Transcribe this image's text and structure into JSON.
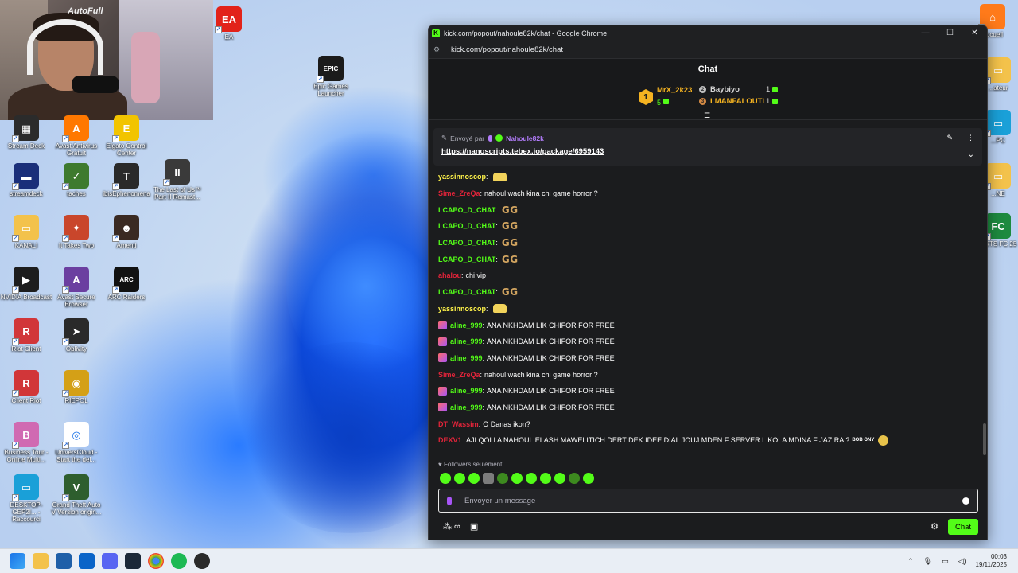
{
  "browser": {
    "window_title": "kick.com/popout/nahoule82k/chat - Google Chrome",
    "url": "kick.com/popout/nahoule82k/chat",
    "favicon_letter": "K"
  },
  "chat": {
    "header": "Chat",
    "leaderboard": {
      "first": {
        "rank": "1",
        "name": "MrX_2k23",
        "count": "5"
      },
      "second": {
        "name": "Baybiyo",
        "count": "1"
      },
      "third": {
        "name": "LMANFALOUTI",
        "count": "1"
      }
    },
    "pinned": {
      "sent_by": "Envoyé par",
      "user": "Nahoule82k",
      "link": "https://nanoscripts.tebex.io/package/6959143"
    },
    "messages": [
      {
        "user": "yassinnoscop",
        "color": "#fff34a",
        "text": "",
        "emote": "hands",
        "badge": false
      },
      {
        "user": "Sime_ZreQa",
        "color": "#e2243a",
        "text": "nahoul wach kina chi game horror ?",
        "emote": "",
        "badge": false
      },
      {
        "user": "LCAPO_D_CHAT",
        "color": "#53fc18",
        "text": "",
        "emote": "GG",
        "badge": false
      },
      {
        "user": "LCAPO_D_CHAT",
        "color": "#53fc18",
        "text": "",
        "emote": "GG",
        "badge": false
      },
      {
        "user": "LCAPO_D_CHAT",
        "color": "#53fc18",
        "text": "",
        "emote": "GG",
        "badge": false
      },
      {
        "user": "LCAPO_D_CHAT",
        "color": "#53fc18",
        "text": "",
        "emote": "GG",
        "badge": false
      },
      {
        "user": "ahalou",
        "color": "#e2243a",
        "text": "chi vip",
        "emote": "",
        "badge": false
      },
      {
        "user": "LCAPO_D_CHAT",
        "color": "#53fc18",
        "text": "",
        "emote": "GG",
        "badge": false
      },
      {
        "user": "yassinnoscop",
        "color": "#fff34a",
        "text": "",
        "emote": "hands",
        "badge": false
      },
      {
        "user": "aline_999",
        "color": "#53fc18",
        "text": "ANA NKHDAM LIK CHIFOR FOR FREE",
        "emote": "",
        "badge": true
      },
      {
        "user": "aline_999",
        "color": "#53fc18",
        "text": "ANA NKHDAM LIK CHIFOR FOR FREE",
        "emote": "",
        "badge": true
      },
      {
        "user": "aline_999",
        "color": "#53fc18",
        "text": "ANA NKHDAM LIK CHIFOR FOR FREE",
        "emote": "",
        "badge": true
      },
      {
        "user": "Sime_ZreQa",
        "color": "#e2243a",
        "text": "nahoul wach kina chi game horror ?",
        "emote": "",
        "badge": false
      },
      {
        "user": "aline_999",
        "color": "#53fc18",
        "text": "ANA NKHDAM LIK CHIFOR FOR FREE",
        "emote": "",
        "badge": true
      },
      {
        "user": "aline_999",
        "color": "#53fc18",
        "text": "ANA NKHDAM LIK CHIFOR FOR FREE",
        "emote": "",
        "badge": true
      },
      {
        "user": "DT_Wassim",
        "color": "#e2243a",
        "text": "O Danas ikon?",
        "emote": "",
        "badge": false
      },
      {
        "user": "DEXV1",
        "color": "#e2243a",
        "text": "AJI QOLI A NAHOUL ELASH MAWELITICH DERT DEK IDEE DIAL JOUJ MDEN F SERVER L KOLA MDINA F JAZIRA ?",
        "emote": "bob",
        "badge": false
      }
    ],
    "emote_text": {
      "gg": "GG",
      "bob": "BOB ONY"
    },
    "followers_only": "Followers seulement",
    "input_placeholder": "Envoyer un message",
    "chat_button": "Chat"
  },
  "desktop_icons": [
    {
      "label": "EA",
      "color": "#e2231a",
      "glyph": "EA"
    },
    {
      "label": "Epic Games Launcher",
      "color": "#1b1b1b",
      "glyph": "EPIC"
    },
    {
      "label": "Stream Deck",
      "color": "#2b2b2b",
      "glyph": "▦"
    },
    {
      "label": "Avast Antivirus Gratuit",
      "color": "#ff7800",
      "glyph": "A"
    },
    {
      "label": "Elgato Control Center",
      "color": "#f2c400",
      "glyph": "E"
    },
    {
      "label": "streamdeck",
      "color": "#1a2f7a",
      "glyph": "▬"
    },
    {
      "label": "taches",
      "color": "#3e7a2e",
      "glyph": "✓"
    },
    {
      "label": "ibisEphenomena",
      "color": "#2a2a2a",
      "glyph": "T"
    },
    {
      "label": "The Last of Us™ Part II Remast...",
      "color": "#3a3a3a",
      "glyph": "II"
    },
    {
      "label": "KANALI",
      "color": "#f3c24b",
      "glyph": "▭"
    },
    {
      "label": "It Takes Two",
      "color": "#c9462b",
      "glyph": "✦"
    },
    {
      "label": "Amenti",
      "color": "#3a2a22",
      "glyph": "☻"
    },
    {
      "label": "NVIDIA Broadcast",
      "color": "#1d1d1d",
      "glyph": "▶"
    },
    {
      "label": "Avast Secure Browser",
      "color": "#6b3fa0",
      "glyph": "A"
    },
    {
      "label": "ARC Raiders",
      "color": "#111",
      "glyph": "ARC"
    },
    {
      "label": "Riot Client",
      "color": "#d13639",
      "glyph": "R"
    },
    {
      "label": "Oblivity",
      "color": "#2a2a2a",
      "glyph": "➤"
    },
    {
      "label": "Client Riot",
      "color": "#d13639",
      "glyph": "R"
    },
    {
      "label": "RIEPOL",
      "color": "#d4a017",
      "glyph": "◉"
    },
    {
      "label": "Business Tour - Online Multi...",
      "color": "#d06ab2",
      "glyph": "B"
    },
    {
      "label": "UniversCloud - Start the del...",
      "color": "#ffffff",
      "glyph": "◎"
    },
    {
      "label": "DESKTOP-GEP2I... - Raccourci",
      "color": "#1aa0d8",
      "glyph": "▭"
    },
    {
      "label": "Grand Theft Auto V Version origin...",
      "color": "#2e5e2e",
      "glyph": "V"
    },
    {
      "label": "Accueil",
      "color": "#ff7a1a",
      "glyph": "⌂"
    },
    {
      "label": "...ateur",
      "color": "#f3c24b",
      "glyph": "▭"
    },
    {
      "label": "...PC",
      "color": "#1aa0d8",
      "glyph": "▭"
    },
    {
      "label": "...NE",
      "color": "#f3c24b",
      "glyph": "▭"
    },
    {
      "label": "...RTS FC 25",
      "color": "#1d8a3f",
      "glyph": "FC"
    }
  ],
  "webcam": {
    "brand": "AutoFull"
  },
  "taskbar": {
    "time": "00:03",
    "date": "19/11/2025"
  }
}
